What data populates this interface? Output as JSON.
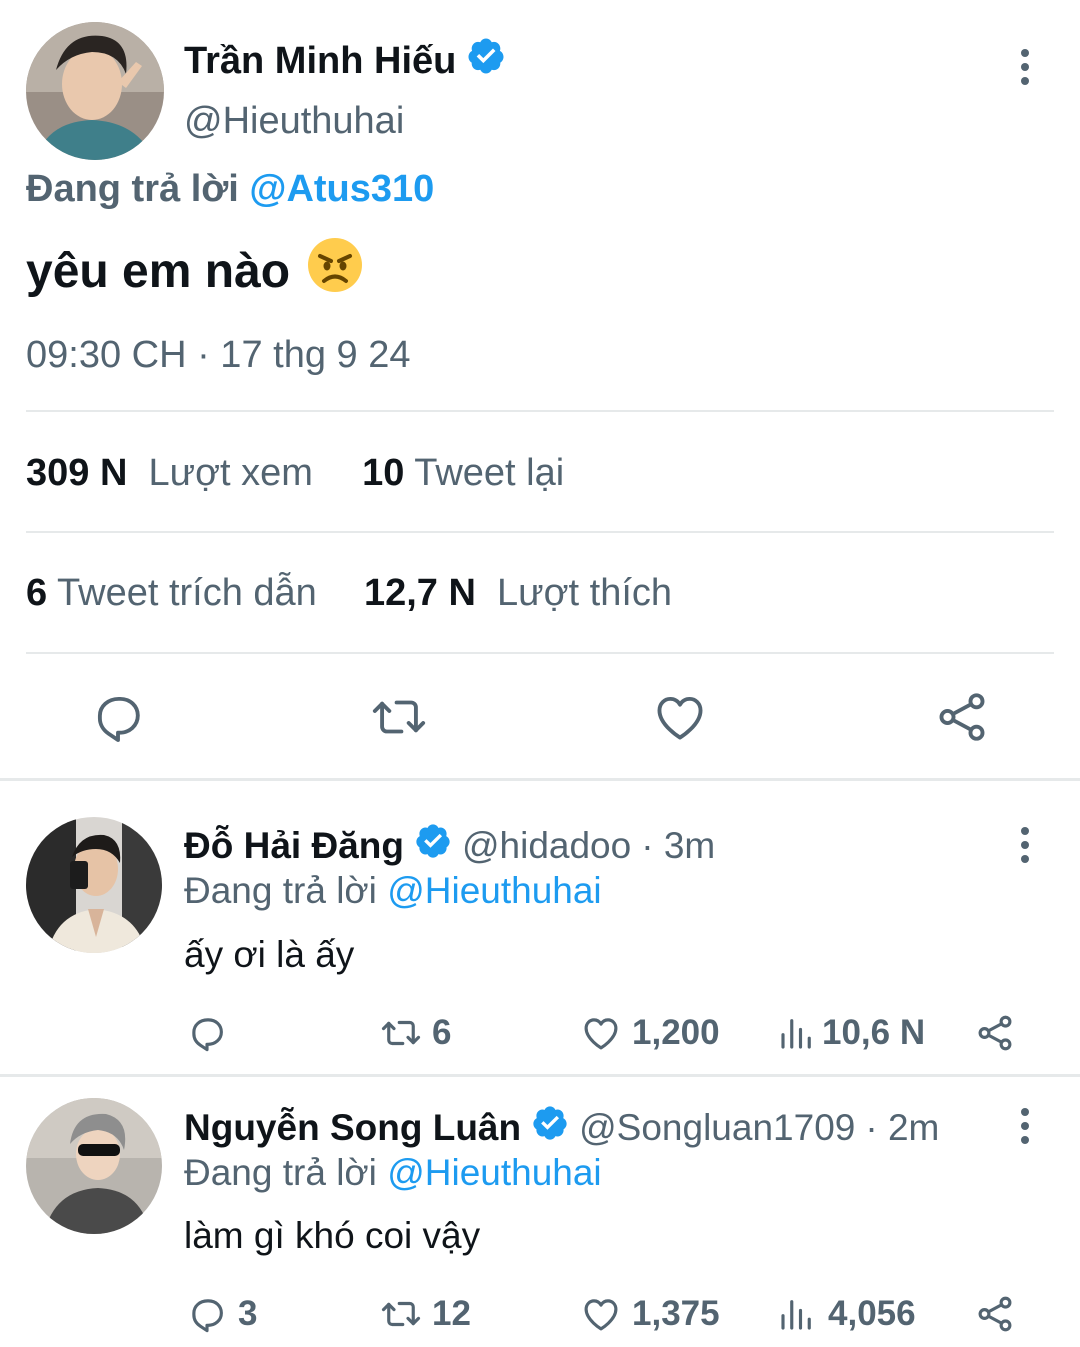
{
  "main_tweet": {
    "author_name": "Trần Minh Hiếu",
    "verified_icon": "verified-badge-icon",
    "handle": "@Hieuthuhai",
    "replying_prefix": "Đang trả lời",
    "replying_to": "@Atus310",
    "text": "yêu em nào",
    "emoji": "😠",
    "timestamp": "09:30 CH · 17 thg 9 24",
    "views_count": "309 N",
    "views_label": "Lượt xem",
    "retweets_count": "10",
    "retweets_label": "Tweet lại",
    "quotes_count": "6",
    "quotes_label": "Tweet trích dẫn",
    "likes_count": "12,7 N",
    "likes_label": "Lượt thích",
    "actions": [
      "reply-icon",
      "retweet-icon",
      "like-icon",
      "share-icon"
    ]
  },
  "replies": [
    {
      "author_name": "Đỗ Hải Đăng",
      "handle": "@hidadoo",
      "time": "· 3m",
      "replying_prefix": "Đang trả lời",
      "replying_to": "@Hieuthuhai",
      "text": "ấy ơi là ấy",
      "reply_count": "",
      "retweet_count": "6",
      "like_count": "1,200",
      "view_count": "10,6 N"
    },
    {
      "author_name": "Nguyễn Song Luân",
      "handle": "@Songluan1709",
      "time": "· 2m",
      "replying_prefix": "Đang trả lời",
      "replying_to": "@Hieuthuhai",
      "text": "làm gì khó coi vậy",
      "reply_count": "3",
      "retweet_count": "12",
      "like_count": "1,375",
      "view_count": "4,056"
    }
  ],
  "colors": {
    "accent": "#1d9bf0",
    "text": "#0f1419",
    "secondary": "#536471",
    "divider": "#e6e9ea"
  }
}
